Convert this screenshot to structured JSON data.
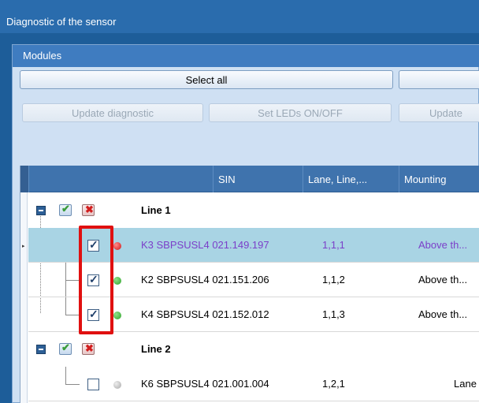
{
  "window": {
    "title": "Diagnostic of the sensor"
  },
  "panel": {
    "title": "Modules"
  },
  "toolbar": {
    "select_all_label": "Select all",
    "update_diagnostic_label": "Update diagnostic",
    "set_leds_label": "Set LEDs ON/OFF",
    "update_label": "Update"
  },
  "grid": {
    "columns": [
      "SIN",
      "Lane, Line,...",
      "Mounting"
    ],
    "groups": [
      {
        "label": "Line 1",
        "rows": [
          {
            "name": "K3 SBPSUSL4 021.149.197",
            "lane": "1,1,1",
            "mounting": "Above th...",
            "checked": true,
            "led": "red-led-icon"
          },
          {
            "name": "K2 SBPSUSL4 021.151.206",
            "lane": "1,1,2",
            "mounting": "Above th...",
            "checked": true,
            "led": "green-led-icon"
          },
          {
            "name": "K4 SBPSUSL4 021.152.012",
            "lane": "1,1,3",
            "mounting": "Above th...",
            "checked": true,
            "led": "green-led-icon"
          }
        ]
      },
      {
        "label": "Line 2",
        "rows": [
          {
            "name": "K6 SBPSUSL4 021.001.004",
            "lane": "1,2,1",
            "mounting": "Lane",
            "checked": false,
            "led": "gray-led-icon"
          }
        ]
      }
    ]
  },
  "colors": {
    "led_red": "#e02020",
    "led_green": "#33b52e",
    "led_gray": "#bdbdbd",
    "highlight": "#e01010",
    "selected_row": "#a9d4e4"
  }
}
